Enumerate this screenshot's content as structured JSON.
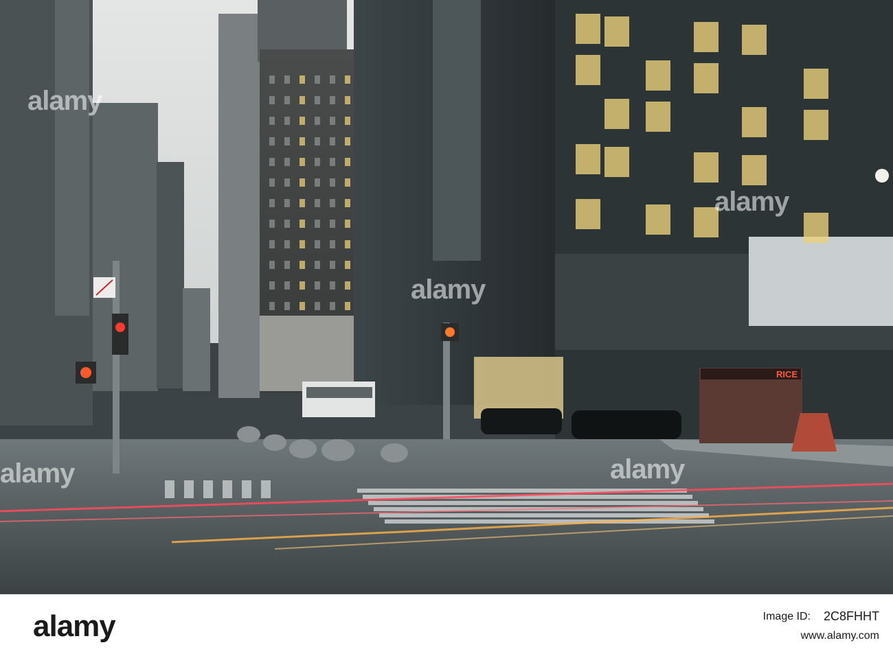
{
  "watermark": {
    "text": "alamy"
  },
  "footer": {
    "logo": "alamy",
    "image_id_label": "Image ID:",
    "image_id": "2C8FHHT",
    "url": "www.alamy.com"
  },
  "scene": {
    "cart_sign": "RICE"
  },
  "colors": {
    "sky": "#dcdedd",
    "glass_tower": "#2c3336",
    "window_light": "#e8cf7a",
    "traffic_red": "#ff3b2f",
    "light_trail_red": "#ff4a5a",
    "light_trail_amber": "#ffb347"
  }
}
